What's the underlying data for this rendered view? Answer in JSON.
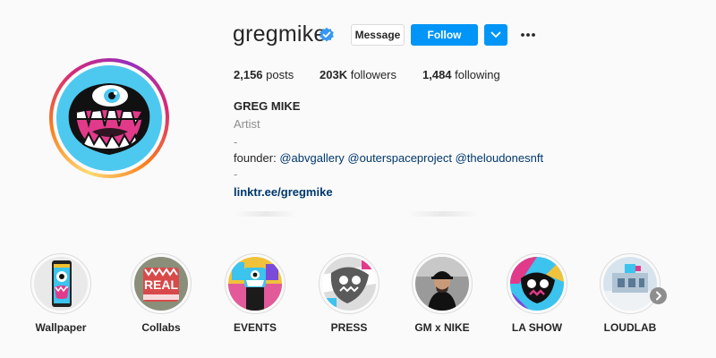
{
  "profile": {
    "username": "gregmike",
    "verified_icon": "verified-badge-icon",
    "avatar_icon": "cyclops-monster-avatar",
    "colors": {
      "accent": "#0095f6",
      "verified": "#3897f0",
      "link": "#00376b",
      "avatar_bg": "#4dc9f0",
      "avatar_mouth": "#e23a8a"
    }
  },
  "actions": {
    "message_label": "Message",
    "follow_label": "Follow",
    "dropdown_icon": "chevron-down-icon",
    "more_icon": "ellipsis-icon"
  },
  "stats": {
    "posts_count": "2,156",
    "posts_label": "posts",
    "followers_count": "203K",
    "followers_label": "followers",
    "following_count": "1,484",
    "following_label": "following"
  },
  "bio": {
    "name": "GREG MIKE",
    "category": "Artist",
    "dash": "-",
    "founder_prefix": "founder: ",
    "mention1": "@abvgallery",
    "mention2": "@outerspaceproject",
    "mention3": "@theloudonesnft",
    "link": "linktr.ee/gregmike"
  },
  "highlights": [
    {
      "label": "Wallpaper"
    },
    {
      "label": "Collabs"
    },
    {
      "label": "EVENTS"
    },
    {
      "label": "PRESS"
    },
    {
      "label": "GM x NIKE"
    },
    {
      "label": "LA SHOW"
    },
    {
      "label": "LOUDLAB"
    }
  ],
  "highlights_next_icon": "chevron-right-icon"
}
